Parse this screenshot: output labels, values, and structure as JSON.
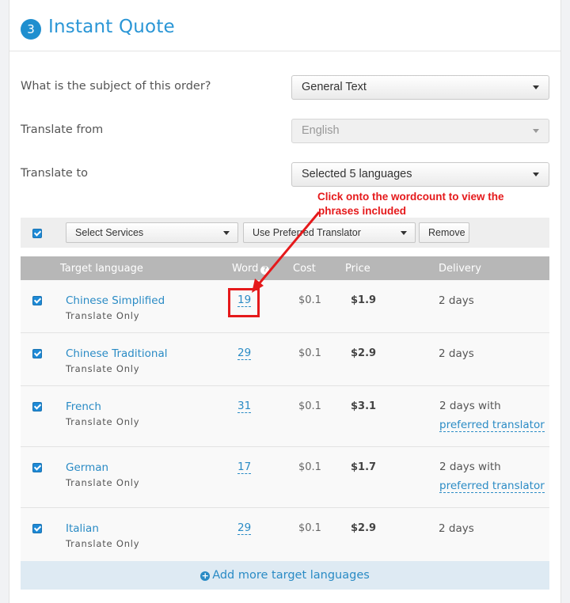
{
  "header": {
    "step": "3",
    "title": "Instant Quote"
  },
  "form": {
    "subject_label": "What is the subject of this order?",
    "subject_value": "General Text",
    "from_label": "Translate from",
    "from_value": "English",
    "to_label": "Translate to",
    "to_value": "Selected 5 languages"
  },
  "toolbar": {
    "select_services": "Select Services",
    "use_preferred": "Use Preferred Translator",
    "remove": "Remove"
  },
  "table": {
    "headers": {
      "target": "Target language",
      "word": "Word",
      "cost": "Cost",
      "price": "Price",
      "delivery": "Delivery"
    },
    "rows": [
      {
        "lang": "Chinese Simplified",
        "service": "Translate Only",
        "words": "19",
        "cost": "$0.1",
        "price": "$1.9",
        "delivery": "2 days"
      },
      {
        "lang": "Chinese Traditional",
        "service": "Translate Only",
        "words": "29",
        "cost": "$0.1",
        "price": "$2.9",
        "delivery": "2 days"
      },
      {
        "lang": "French",
        "service": "Translate Only",
        "words": "31",
        "cost": "$0.1",
        "price": "$3.1",
        "delivery": "2 days with",
        "delivery_link": "preferred translator"
      },
      {
        "lang": "German",
        "service": "Translate Only",
        "words": "17",
        "cost": "$0.1",
        "price": "$1.7",
        "delivery": "2 days with",
        "delivery_link": "preferred translator"
      },
      {
        "lang": "Italian",
        "service": "Translate Only",
        "words": "29",
        "cost": "$0.1",
        "price": "$2.9",
        "delivery": "2 days"
      }
    ]
  },
  "add_more": "Add more target languages",
  "annotation": {
    "line1": "Click onto the wordcount to view the",
    "line2": "phrases included",
    "color": "#e5191b"
  },
  "colors": {
    "accent": "#2a96d6",
    "checkbox": "#1e8ad6",
    "header_bg": "#b7b7b7"
  }
}
